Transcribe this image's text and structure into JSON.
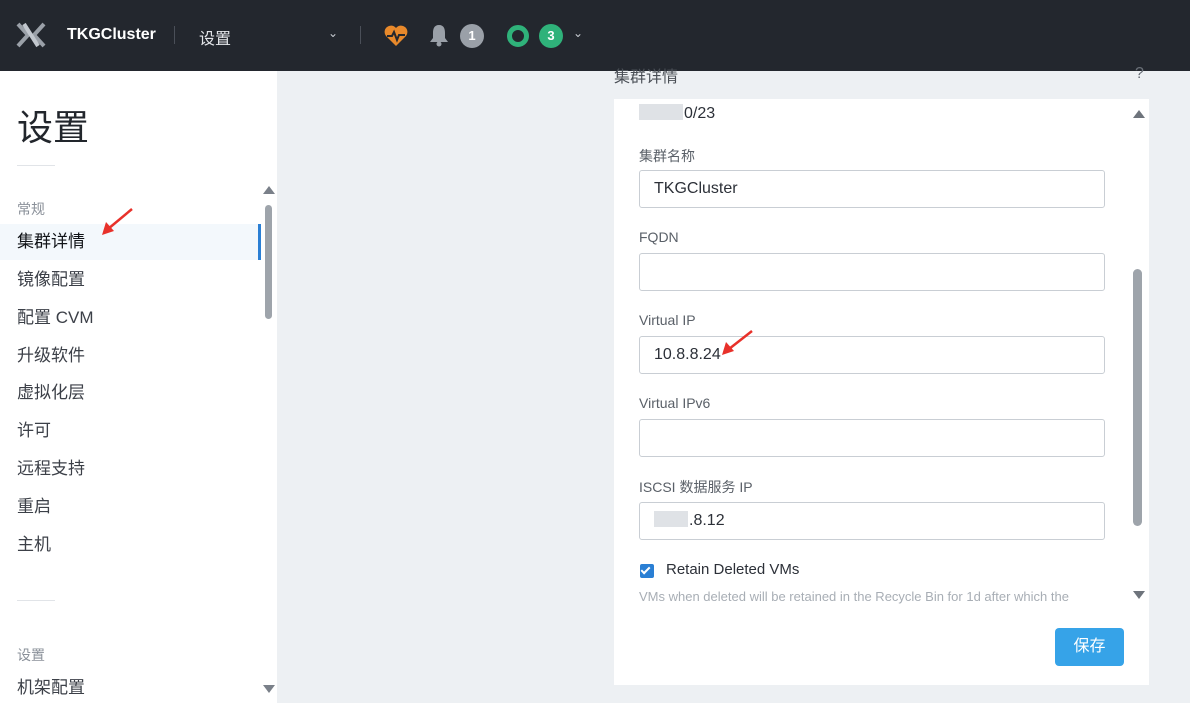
{
  "header": {
    "app_title": "TKGCluster",
    "nav_label": "设置",
    "alert_count": "1",
    "task_count": "3",
    "icons": [
      "x-logo-icon",
      "health-icon",
      "bell-icon",
      "task-status-icon",
      "chevron-down-icon"
    ]
  },
  "sidebar": {
    "title": "设置",
    "section_general": "常规",
    "items": [
      {
        "label": "集群详情"
      },
      {
        "label": "镜像配置"
      },
      {
        "label": "配置 CVM"
      },
      {
        "label": "升级软件"
      },
      {
        "label": "虚拟化层"
      },
      {
        "label": "许可"
      },
      {
        "label": "远程支持"
      },
      {
        "label": "重启"
      },
      {
        "label": "主机"
      }
    ],
    "section_settings": "设置",
    "items2": [
      {
        "label": "机架配置"
      }
    ]
  },
  "panel": {
    "header": "集群详情",
    "help": "?",
    "subnet_suffix": "0/23",
    "fields": {
      "cluster_name": {
        "label": "集群名称",
        "value": "TKGCluster"
      },
      "fqdn": {
        "label": "FQDN",
        "value": ""
      },
      "virtual_ip": {
        "label": "Virtual IP",
        "value": "10.8.8.24"
      },
      "virtual_ipv6": {
        "label": "Virtual IPv6",
        "value": ""
      },
      "iscsi_ip": {
        "label": "ISCSI 数据服务 IP",
        "value_suffix": ".8.12"
      }
    },
    "retain_vms": {
      "label": "Retain Deleted VMs",
      "checked": true,
      "description": "VMs when deleted will be retained in the Recycle Bin for 1d after which the"
    },
    "save_label": "保存"
  },
  "colors": {
    "topbar": "#23272e",
    "accent": "#2a7fd4",
    "save_button": "#36a3e8",
    "health": "#e8892b",
    "task_green": "#2fb27a",
    "annotation_red": "#e8312a"
  }
}
